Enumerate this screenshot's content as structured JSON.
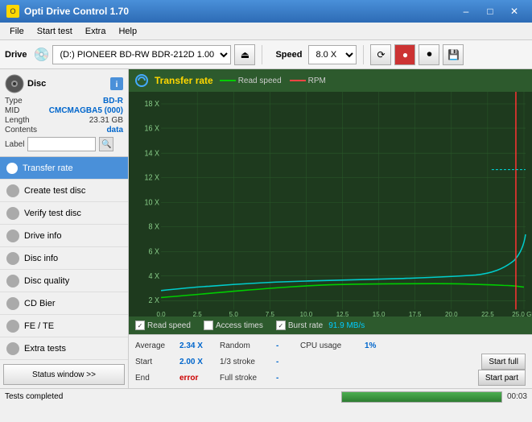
{
  "titlebar": {
    "title": "Opti Drive Control 1.70",
    "icon": "O"
  },
  "menu": {
    "items": [
      "File",
      "Start test",
      "Extra",
      "Help"
    ]
  },
  "toolbar": {
    "drive_label": "Drive",
    "drive_value": "(D:) PIONEER BD-RW  BDR-212D 1.00",
    "speed_label": "Speed",
    "speed_value": "8.0 X"
  },
  "disc": {
    "type_label": "Type",
    "type_value": "BD-R",
    "mid_label": "MID",
    "mid_value": "CMCMAGBA5 (000)",
    "length_label": "Length",
    "length_value": "23.31 GB",
    "contents_label": "Contents",
    "contents_value": "data",
    "label_label": "Label",
    "label_value": ""
  },
  "nav": {
    "items": [
      {
        "id": "transfer-rate",
        "label": "Transfer rate",
        "active": true
      },
      {
        "id": "create-test-disc",
        "label": "Create test disc",
        "active": false
      },
      {
        "id": "verify-test-disc",
        "label": "Verify test disc",
        "active": false
      },
      {
        "id": "drive-info",
        "label": "Drive info",
        "active": false
      },
      {
        "id": "disc-info",
        "label": "Disc info",
        "active": false
      },
      {
        "id": "disc-quality",
        "label": "Disc quality",
        "active": false
      },
      {
        "id": "cd-bier",
        "label": "CD Bier",
        "active": false
      },
      {
        "id": "fe-te",
        "label": "FE / TE",
        "active": false
      },
      {
        "id": "extra-tests",
        "label": "Extra tests",
        "active": false
      }
    ],
    "status_btn": "Status window >>"
  },
  "chart": {
    "title": "Transfer rate",
    "legend_read": "Read speed",
    "legend_rpm": "RPM",
    "y_labels": [
      "18 X",
      "16 X",
      "14 X",
      "12 X",
      "10 X",
      "8 X",
      "6 X",
      "4 X",
      "2 X"
    ],
    "x_labels": [
      "0.0",
      "2.5",
      "5.0",
      "7.5",
      "10.0",
      "12.5",
      "15.0",
      "17.5",
      "20.0",
      "22.5",
      "25.0 GB"
    ],
    "checkboxes": [
      {
        "id": "read-speed",
        "label": "Read speed",
        "checked": true
      },
      {
        "id": "access-times",
        "label": "Access times",
        "checked": false
      },
      {
        "id": "burst-rate",
        "label": "Burst rate",
        "checked": true,
        "value": "91.9 MB/s"
      }
    ]
  },
  "stats": {
    "rows": [
      {
        "col1_label": "Average",
        "col1_value": "2.34 X",
        "col2_label": "Random",
        "col2_value": "-",
        "col3_label": "CPU usage",
        "col3_value": "1%"
      },
      {
        "col1_label": "Start",
        "col1_value": "2.00 X",
        "col2_label": "1/3 stroke",
        "col2_value": "-",
        "col3_label": "",
        "col3_value": "",
        "btn": "Start full"
      },
      {
        "col1_label": "End",
        "col1_value": "error",
        "col2_label": "Full stroke",
        "col2_value": "-",
        "col3_label": "",
        "col3_value": "",
        "btn": "Start part"
      }
    ]
  },
  "statusbar": {
    "text": "Tests completed",
    "progress": 100,
    "time": "00:03"
  }
}
